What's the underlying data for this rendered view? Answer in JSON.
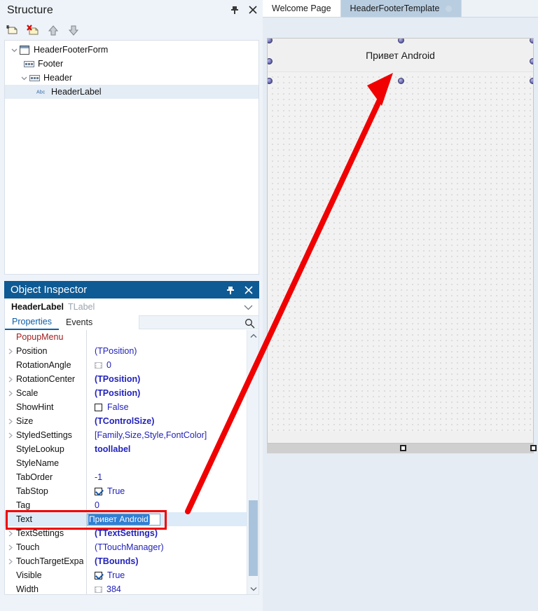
{
  "structure": {
    "title": "Structure",
    "pin_icon": "pin-icon",
    "close_icon": "close-icon",
    "toolbar": [
      {
        "name": "new-item-icon",
        "label": "New Item"
      },
      {
        "name": "delete-item-icon",
        "label": "Delete Item"
      },
      {
        "name": "move-up-icon",
        "label": "Move Up"
      },
      {
        "name": "move-down-icon",
        "label": "Move Down"
      }
    ],
    "tree": [
      {
        "label": "HeaderFooterForm",
        "indent": 0,
        "twisty": "expanded",
        "icon": "form-icon",
        "selected": false
      },
      {
        "label": "Footer",
        "indent": 1,
        "twisty": "none",
        "icon": "toolbar-icon",
        "selected": false
      },
      {
        "label": "Header",
        "indent": 1,
        "twisty": "expanded",
        "icon": "toolbar-icon",
        "selected": false
      },
      {
        "label": "HeaderLabel",
        "indent": 2,
        "twisty": "none",
        "icon": "abc-icon",
        "selected": true
      }
    ]
  },
  "object_inspector": {
    "title": "Object Inspector",
    "pin_icon": "pin-icon",
    "close_icon": "close-icon",
    "object_name": "HeaderLabel",
    "object_class": "TLabel",
    "dropdown_icon": "chevron-down-icon",
    "tabs": [
      {
        "label": "Properties",
        "active": true
      },
      {
        "label": "Events",
        "active": false
      }
    ],
    "search_placeholder": "",
    "search_value": "",
    "search_icon": "search-icon",
    "scroll_up_icon": "chevron-up-icon",
    "scroll_down_icon": "chevron-down-icon",
    "properties": [
      {
        "name": "PopupMenu",
        "value": "",
        "expandable": false,
        "style": "red",
        "valstyle": "none"
      },
      {
        "name": "Position",
        "value": "(TPosition)",
        "expandable": true,
        "style": "normal",
        "valstyle": "plain"
      },
      {
        "name": "RotationAngle",
        "value": "0",
        "expandable": false,
        "style": "normal",
        "valstyle": "film"
      },
      {
        "name": "RotationCenter",
        "value": "(TPosition)",
        "expandable": true,
        "style": "normal",
        "valstyle": "bold"
      },
      {
        "name": "Scale",
        "value": "(TPosition)",
        "expandable": true,
        "style": "normal",
        "valstyle": "bold"
      },
      {
        "name": "ShowHint",
        "value": "False",
        "expandable": false,
        "style": "normal",
        "valstyle": "checkbox-off"
      },
      {
        "name": "Size",
        "value": "(TControlSize)",
        "expandable": true,
        "style": "normal",
        "valstyle": "bold"
      },
      {
        "name": "StyledSettings",
        "value": "[Family,Size,Style,FontColor]",
        "expandable": true,
        "style": "normal",
        "valstyle": "plain"
      },
      {
        "name": "StyleLookup",
        "value": "toollabel",
        "expandable": false,
        "style": "normal",
        "valstyle": "bold"
      },
      {
        "name": "StyleName",
        "value": "",
        "expandable": false,
        "style": "normal",
        "valstyle": "none"
      },
      {
        "name": "TabOrder",
        "value": "-1",
        "expandable": false,
        "style": "normal",
        "valstyle": "plain"
      },
      {
        "name": "TabStop",
        "value": "True",
        "expandable": false,
        "style": "normal",
        "valstyle": "checkbox-on"
      },
      {
        "name": "Tag",
        "value": "0",
        "expandable": false,
        "style": "normal",
        "valstyle": "plain"
      },
      {
        "name": "Text",
        "value": "Привет Android",
        "expandable": false,
        "style": "normal",
        "valstyle": "editing",
        "highlighted": true
      },
      {
        "name": "TextSettings",
        "value": "(TTextSettings)",
        "expandable": true,
        "style": "normal",
        "valstyle": "bold"
      },
      {
        "name": "Touch",
        "value": "(TTouchManager)",
        "expandable": true,
        "style": "normal",
        "valstyle": "plain"
      },
      {
        "name": "TouchTargetExpansion",
        "value": "(TBounds)",
        "expandable": true,
        "style": "normal",
        "valstyle": "bold"
      },
      {
        "name": "Visible",
        "value": "True",
        "expandable": false,
        "style": "normal",
        "valstyle": "checkbox-on"
      },
      {
        "name": "Width",
        "value": "384",
        "expandable": false,
        "style": "normal",
        "valstyle": "film"
      }
    ]
  },
  "editor": {
    "tabs": [
      {
        "label": "Welcome Page",
        "active": false,
        "closable": false
      },
      {
        "label": "HeaderFooterTemplate",
        "active": true,
        "closable": true
      }
    ]
  },
  "designer": {
    "header_label_text": "Привет Android",
    "selection_handle_icon": "selection-handle",
    "resize_handle_icon": "resize-handle"
  },
  "annotation": {
    "arrow_color": "#f00000",
    "box_color": "#f00000",
    "arrow_icon": "red-arrow-annotation",
    "box_icon": "red-highlight-box"
  },
  "colors": {
    "oi_titlebar": "#0e5a94",
    "panel_bg": "#eef3f9",
    "tab_active": "#b8cde0",
    "selection_blue": "#2f7fd4",
    "value_blue": "#2222bb",
    "accent_red": "#a02020"
  }
}
